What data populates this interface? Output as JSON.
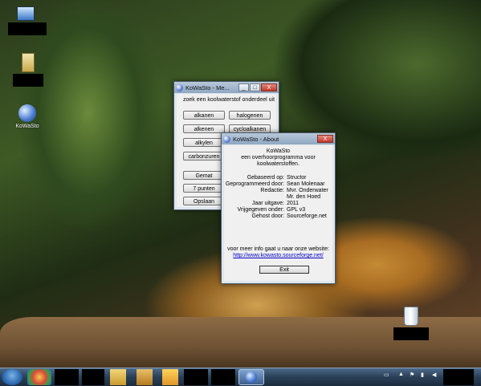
{
  "desktop": {
    "icons": [
      {
        "label": ""
      },
      {
        "label": ""
      },
      {
        "label": "KoWaSto"
      }
    ]
  },
  "menu_window": {
    "title": "KoWaSto - Me...",
    "header": "zoek een koolwaterstof onderdeel uit",
    "buttons": [
      "alkanen",
      "halogenen",
      "alkenen",
      "cycloalkanen",
      "alkylen",
      "carbonzuren",
      "Gemat",
      "7 punten",
      "Opslaan"
    ]
  },
  "about_window": {
    "title": "KoWaSto - About",
    "app_name": "KoWaSto",
    "desc1": "een overhoorprogramma voor",
    "desc2": "koolwaterstoffen.",
    "rows": [
      {
        "k": "Gebaseerd op:",
        "v": "Structor"
      },
      {
        "k": "Geprogrammeerd door:",
        "v": "Sean Molenaar"
      },
      {
        "k": "Redactie:",
        "v": "Mvr. Onderwater"
      },
      {
        "k": "",
        "v": "Mr. den Hoed"
      },
      {
        "k": "Jaar uitgave:",
        "v": "2011"
      },
      {
        "k": "Vrijgegeven onder:",
        "v": "GPL v3"
      },
      {
        "k": "Gehost door:",
        "v": "Sourceforge.net"
      }
    ],
    "more_info": "voor meer info gaat u naar onze website:",
    "link": "http://www.kowasto.sourceforge.net/",
    "exit_label": "Exit"
  },
  "window_controls": {
    "minimize": "_",
    "maximize": "□",
    "close": "X"
  }
}
